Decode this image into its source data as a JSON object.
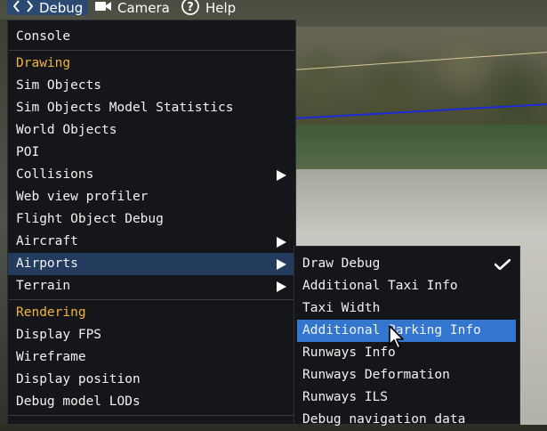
{
  "menubar": {
    "debug": "Debug",
    "camera": "Camera",
    "help": "Help"
  },
  "debug_menu": {
    "console": "Console",
    "section_drawing": "Drawing",
    "sim_objects": "Sim Objects",
    "sim_objects_model_statistics": "Sim Objects Model Statistics",
    "world_objects": "World Objects",
    "poi": "POI",
    "collisions": "Collisions",
    "web_view_profiler": "Web view profiler",
    "flight_object_debug": "Flight Object Debug",
    "aircraft": "Aircraft",
    "airports": "Airports",
    "terrain": "Terrain",
    "section_rendering": "Rendering",
    "display_fps": "Display FPS",
    "wireframe": "Wireframe",
    "display_position": "Display position",
    "debug_model_lods": "Debug model LODs"
  },
  "airports_submenu": {
    "draw_debug": "Draw Debug",
    "draw_debug_checked": true,
    "additional_taxi_info": "Additional Taxi Info",
    "taxi_width": "Taxi Width",
    "additional_parking_info": "Additional Parking Info",
    "runways_info": "Runways Info",
    "runways_deformation": "Runways Deformation",
    "runways_ils": "Runways ILS",
    "debug_navigation_data": "Debug navigation data"
  },
  "colors": {
    "menu_bg": "#14161a",
    "section_header": "#f3b33d",
    "hover_dark": "#233c5e",
    "hover_bright": "#3276d0",
    "menubar_active": "#2b4a73"
  },
  "icons": {
    "debug": "code-brackets-icon",
    "camera": "video-camera-icon",
    "help": "question-circle-icon",
    "submenu": "triangle-right-icon",
    "check": "checkmark-icon",
    "cursor": "mouse-pointer-icon"
  }
}
